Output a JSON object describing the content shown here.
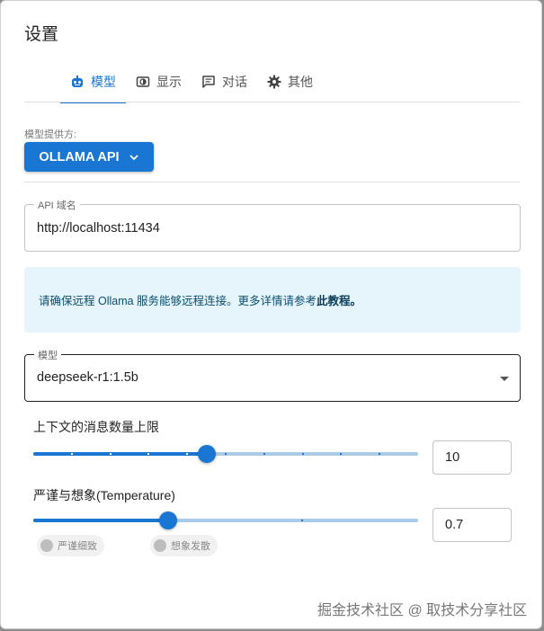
{
  "dialog": {
    "title": "设置"
  },
  "tabs": [
    {
      "label": "模型",
      "icon": "robot-icon"
    },
    {
      "label": "显示",
      "icon": "display-icon"
    },
    {
      "label": "对话",
      "icon": "chat-icon"
    },
    {
      "label": "其他",
      "icon": "gear-icon"
    }
  ],
  "provider": {
    "label": "模型提供方:",
    "value": "OLLAMA API"
  },
  "api_host": {
    "label": "API 域名",
    "value": "http://localhost:11434"
  },
  "info": {
    "text": "请确保远程 Ollama 服务能够远程连接。更多详情请参考",
    "link": "此教程。"
  },
  "model": {
    "label": "模型",
    "value": "deepseek-r1:1.5b"
  },
  "context_limit": {
    "label": "上下文的消息数量上限",
    "value": "10",
    "fraction": 0.45
  },
  "temperature": {
    "label": "严谨与想象(Temperature)",
    "value": "0.7",
    "fraction": 0.35,
    "chip_left": "严谨细致",
    "chip_right": "想象发散"
  },
  "watermark": "掘金技术社区 @ 取技术分享社区",
  "colors": {
    "accent": "#1976d2",
    "info_bg": "#e6f5fc",
    "rail": "#a9cbe9"
  }
}
